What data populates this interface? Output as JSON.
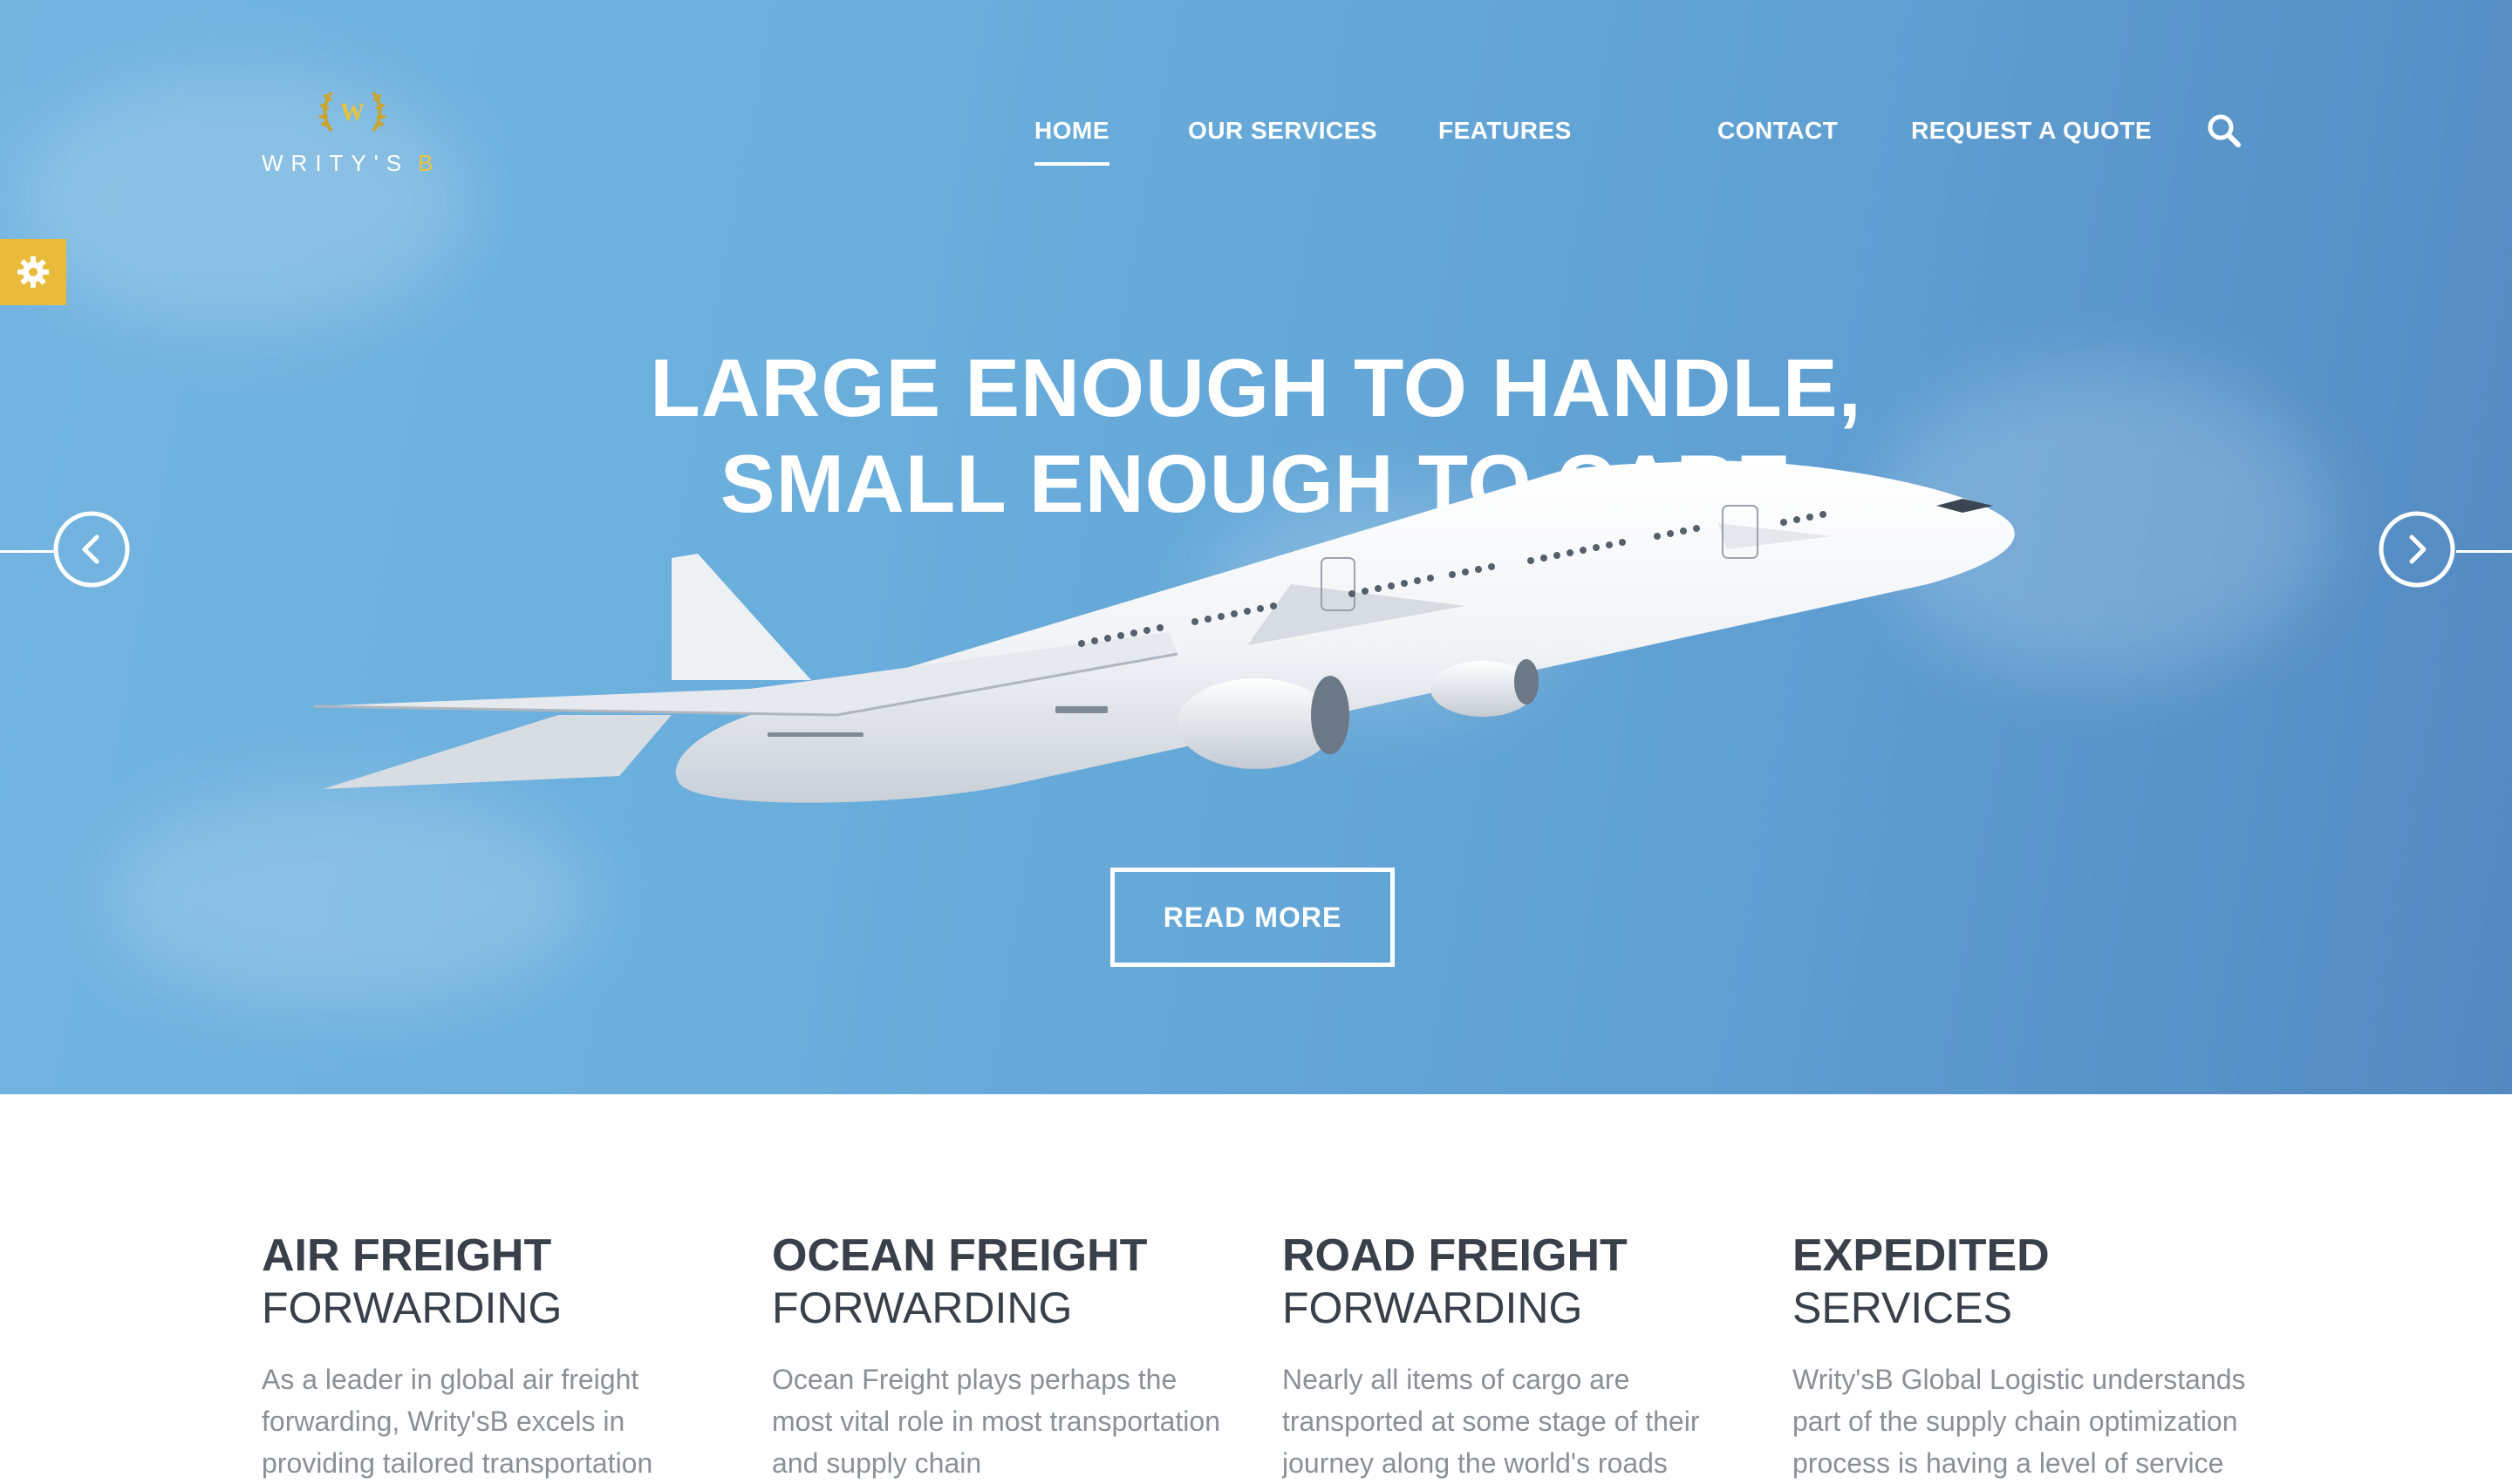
{
  "brand": {
    "name": "WRITY'S",
    "suffix": "B",
    "emblem_letter": "W",
    "accent_color": "#e8c43a"
  },
  "nav": {
    "items": [
      {
        "label": "HOME",
        "active": true
      },
      {
        "label": "OUR SERVICES",
        "active": false
      },
      {
        "label": "FEATURES",
        "active": false
      },
      {
        "label": "CONTACT",
        "active": false
      },
      {
        "label": "REQUEST A QUOTE",
        "active": false
      }
    ],
    "search_icon": "search-icon"
  },
  "settings": {
    "icon": "gear-icon",
    "color": "#e9bb3a"
  },
  "hero": {
    "headline_line1": "LARGE ENOUGH TO HANDLE,",
    "headline_line2": "SMALL ENOUGH TO CARE",
    "cta_label": "READ MORE",
    "prev_icon": "chevron-left-icon",
    "next_icon": "chevron-right-icon",
    "background_color": "#6aaedc"
  },
  "services": [
    {
      "title_bold": "AIR FREIGHT",
      "title_light": "FORWARDING",
      "text": "As a leader in global air freight forwarding, Writy'sB excels in providing tailored transportation"
    },
    {
      "title_bold": "OCEAN FREIGHT",
      "title_light": "FORWARDING",
      "text": "Ocean Freight plays perhaps the most vital role in most transportation and supply chain"
    },
    {
      "title_bold": "ROAD FREIGHT",
      "title_light": "FORWARDING",
      "text": "Nearly all items of cargo are transported at some stage of their journey along the world's roads"
    },
    {
      "title_bold": "EXPEDITED",
      "title_light": "SERVICES",
      "text": "Writy'sB Global Logistic understands part of the supply chain optimization process is having a level of service"
    }
  ]
}
